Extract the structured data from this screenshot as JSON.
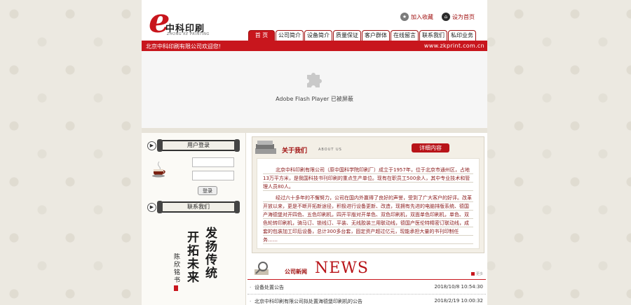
{
  "header": {
    "logo_cn": "中科印刷",
    "logo_en": "ZHONG KE PRINTING",
    "add_favorite": "加入收藏",
    "set_homepage": "设为首页"
  },
  "nav": {
    "items": [
      "首 页",
      "公司简介",
      "设备简介",
      "质量保证",
      "客户群体",
      "在线留言",
      "联系我们",
      "私印业务"
    ]
  },
  "bar": {
    "welcome": "北京中科印刷有限公司欢迎您!",
    "url": "www.zkprint.com.cn"
  },
  "flash": {
    "message": "Adobe Flash Player 已被屏蔽"
  },
  "sidebar": {
    "login_title": "用户登录",
    "login_button": "登录",
    "contact_title": "联系我们",
    "calligraphy": [
      "发扬传统",
      "开拓未来",
      "陈欣铭书"
    ]
  },
  "about": {
    "title": "关于我们",
    "subtitle": "ABOUT US",
    "more": "详细内容",
    "para1": "北京中科印刷有限公司（原中国科学院印刷厂）成立于1957年，位于北京市通州区，占地13万平方米，是我国科技书刊印刷的重点生产单位。现有在职员工500余人，其中专业技术和管理人员80人。",
    "para2": "经过六十多年的不懈努力，公司在国内外赢得了良好的声誉，受到了广大客户的好评。改革开放以来，更是不断开拓新途径，积极进行设备更新、改造，现拥有先进的电脑排版系统、德国产海德堡对开四色、五色印刷机，四开平版对开单色、双色印刷机，双面单色印刷机，单色、双色轮转印刷机，骑马订、锁线订、平装、无线胶装三用联动线，德国产医伦特精密订联动线，成套的包装加工印后设备，总计300多台套，固定资产超过亿元，现能承担大量的书刊印制任务……"
  },
  "news": {
    "title": "公司新闻",
    "title_en": "NEWS",
    "more": "更多",
    "items": [
      {
        "title": "设备处置公告",
        "date": "2018/10/8 10:54:30"
      },
      {
        "title": "北京中科印刷有限公司拟处置海德堡印刷机的公告",
        "date": "2018/2/19 10:00:32"
      }
    ]
  },
  "colors": {
    "brand_red": "#c8161d",
    "background": "#ece9e1"
  }
}
